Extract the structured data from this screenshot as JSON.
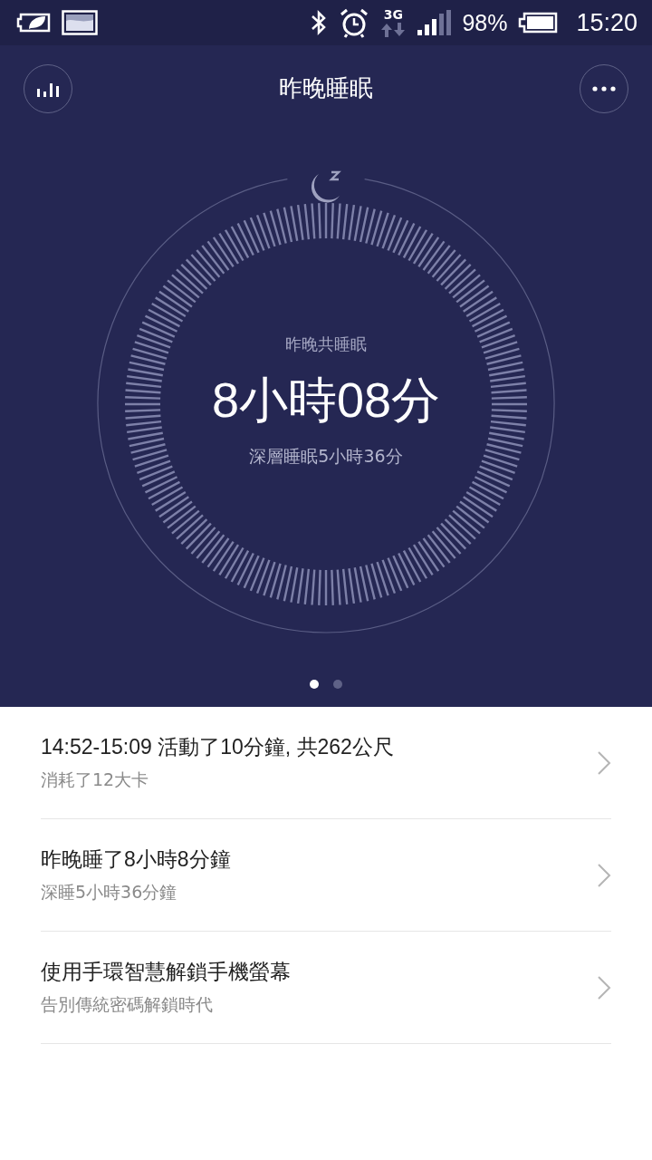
{
  "status_bar": {
    "network": "3G",
    "battery": "98%",
    "time": "15:20"
  },
  "header": {
    "title": "昨晚睡眠"
  },
  "summary": {
    "label": "昨晚共睡眠",
    "total": "8小時08分",
    "deep": "深層睡眠5小時36分"
  },
  "pages": [
    {
      "selected": true
    },
    {
      "selected": false
    }
  ],
  "items": [
    {
      "title": "14:52-15:09 活動了10分鐘, 共262公尺",
      "subtitle": "消耗了12大卡"
    },
    {
      "title": "昨晚睡了8小時8分鐘",
      "subtitle": "深睡5小時36分鐘"
    },
    {
      "title": "使用手環智慧解鎖手機螢幕",
      "subtitle": "告別傳統密碼解鎖時代"
    }
  ]
}
